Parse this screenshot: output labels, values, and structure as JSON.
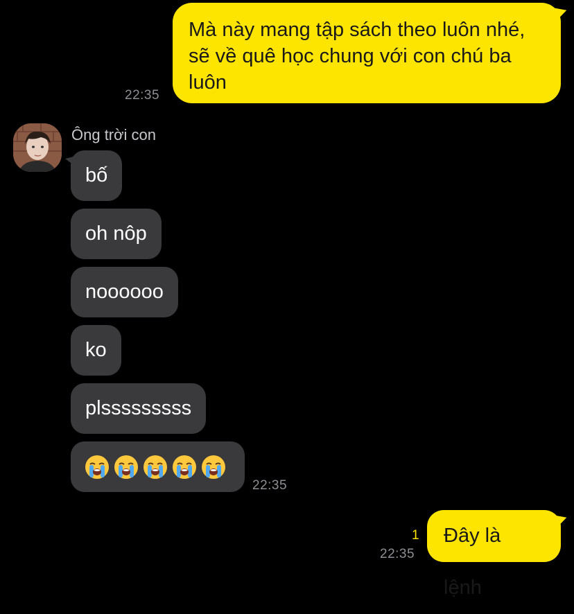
{
  "chat": {
    "messages": [
      {
        "id": "m1",
        "direction": "outgoing",
        "lines": [
          "Mà này mang tập sách theo luôn nhé,",
          "sẽ về quê học chung với con chú ba",
          "luôn"
        ],
        "time": "22:35"
      },
      {
        "id": "m2",
        "direction": "incoming",
        "text": "bố"
      },
      {
        "id": "m3",
        "direction": "incoming",
        "text": "oh nôp"
      },
      {
        "id": "m4",
        "direction": "incoming",
        "text": "noooooo"
      },
      {
        "id": "m5",
        "direction": "incoming",
        "text": "ko"
      },
      {
        "id": "m6",
        "direction": "incoming",
        "text": "plsssssssss"
      },
      {
        "id": "m7",
        "direction": "incoming",
        "emoji": [
          "loudly-crying-face",
          "loudly-crying-face",
          "loudly-crying-face",
          "loudly-crying-face",
          "loudly-crying-face"
        ],
        "time": "22:35"
      },
      {
        "id": "m8",
        "direction": "outgoing",
        "text": "Đây là lệnh",
        "unread_count": "1",
        "time": "22:35"
      }
    ],
    "sender_name": "Ông trời con"
  },
  "colors": {
    "background": "#000000",
    "outgoing_bubble": "#FEE500",
    "incoming_bubble": "#3A3A3C",
    "timestamp": "#8E8E93",
    "unread": "#FEE500"
  },
  "icons": {
    "avatar": "user-avatar-photo",
    "emoji": "loudly-crying-face"
  }
}
